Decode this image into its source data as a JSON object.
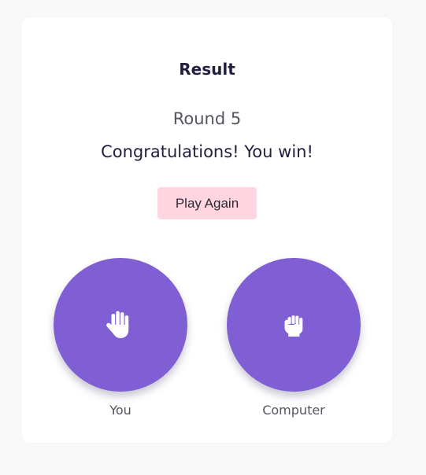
{
  "result": {
    "title": "Result",
    "round": "Round 5",
    "message": "Congratulations! You win!",
    "play_again_label": "Play Again"
  },
  "players": {
    "you": {
      "label": "You",
      "choice_icon": "hand-paper-icon"
    },
    "computer": {
      "label": "Computer",
      "choice_icon": "hand-rock-icon"
    }
  },
  "colors": {
    "background": "#f8f8f9",
    "card": "#ffffff",
    "accent": "#7f5fd3",
    "button": "#ffd6df",
    "heading": "#22203f"
  }
}
